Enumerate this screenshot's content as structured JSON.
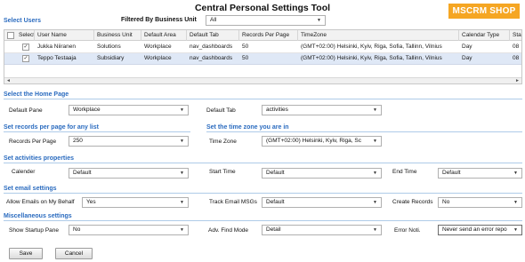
{
  "app": {
    "title": "Central Personal Settings Tool",
    "brand": "MSCRM SHOP",
    "brand_color": "#f5a623"
  },
  "users": {
    "heading": "Select Users",
    "filter_label": "Filtered  By Business Unit",
    "filter_value": "All",
    "columns": [
      "Select",
      "User Name",
      "Business Unit",
      "Default Area",
      "Default Tab",
      "Records Per Page",
      "TimeZone",
      "Calendar Type",
      "Sta"
    ],
    "rows": [
      {
        "checked": "✓",
        "user": "Jukka Niiranen",
        "bu": "Solutions",
        "area": "Workplace",
        "tab": "nav_dashboards",
        "rpp": "50",
        "tz": "(GMT+02:00) Helsinki, Kyiv, Riga, Sofia, Tallinn, Vilnius",
        "cal": "Day",
        "sta": "08"
      },
      {
        "checked": "✓",
        "user": "Teppo Testaaja",
        "bu": "Subsidiary",
        "area": "Workplace",
        "tab": "nav_dashboards",
        "rpp": "50",
        "tz": "(GMT+02:00) Helsinki, Kyiv, Riga, Sofia, Tallinn, Vilnius",
        "cal": "Day",
        "sta": "08"
      }
    ]
  },
  "home": {
    "heading": "Select the Home Page",
    "pane_label": "Default Pane",
    "pane_value": "Workplace",
    "tab_label": "Default Tab",
    "tab_value": "activities"
  },
  "records": {
    "heading": "Set records per page for any list",
    "label": "Records Per Page",
    "value": "250"
  },
  "timezone": {
    "heading": "Set the time zone you are in",
    "label": "Time Zone",
    "value": "(GMT+02:00) Helsinki, Kyiv, Riga, Sc"
  },
  "activities": {
    "heading": "Set activities properties",
    "calendar_label": "Calender",
    "calendar_value": "Default",
    "start_label": "Start Time",
    "start_value": "Default",
    "end_label": "End Time",
    "end_value": "Default"
  },
  "email": {
    "heading": "Set email settings",
    "allow_label": "Allow Emails on My Behalf",
    "allow_value": "Yes",
    "track_label": "Track Email MSGs",
    "track_value": "Default",
    "create_label": "Create Records",
    "create_value": "No"
  },
  "misc": {
    "heading": "Miscellaneous settings",
    "startup_label": "Show Startup Pane",
    "startup_value": "No",
    "find_label": "Adv. Find Mode",
    "find_value": "Detail",
    "error_label": "Error Noti.",
    "error_value": "Never send an error repo"
  },
  "actions": {
    "save": "Save",
    "cancel": "Cancel"
  },
  "colors": {
    "section_heading": "#2a6bbf",
    "selected_row": "#dfe8f6",
    "rule": "#aecbe8"
  }
}
